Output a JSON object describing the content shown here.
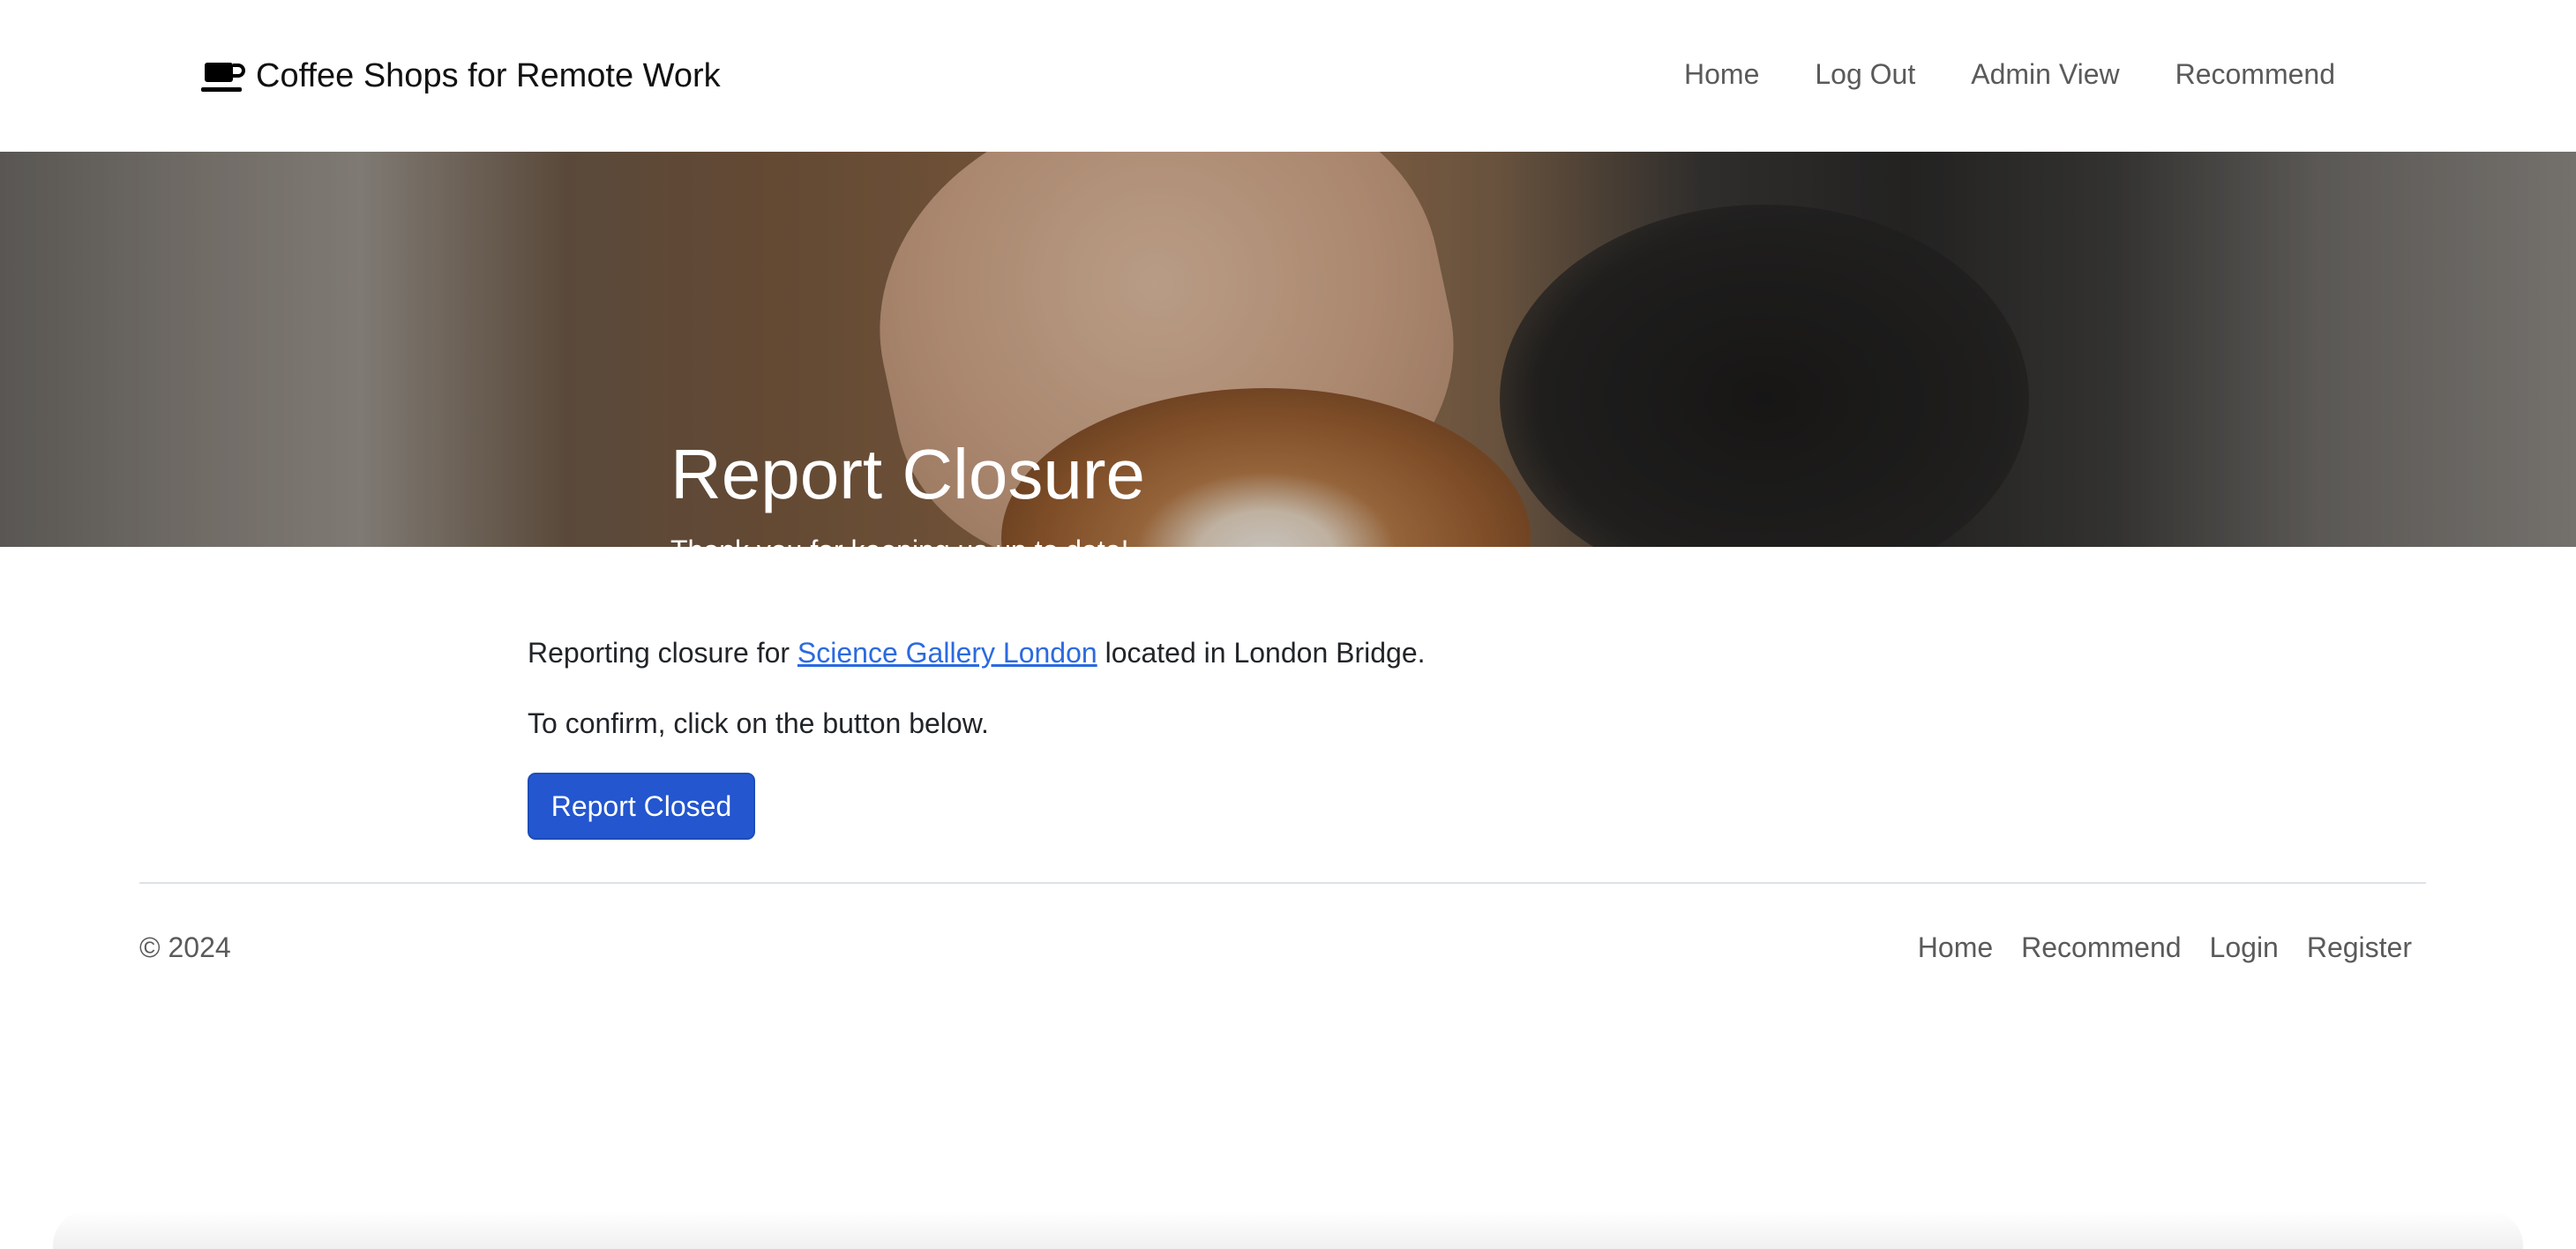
{
  "header": {
    "brand_icon": "coffee-cup-icon",
    "brand_title": "Coffee Shops for Remote Work",
    "nav": [
      {
        "label": "Home"
      },
      {
        "label": "Log Out"
      },
      {
        "label": "Admin View"
      },
      {
        "label": "Recommend"
      }
    ]
  },
  "hero": {
    "title": "Report Closure",
    "subtitle": "Thank you for keeping us up to date!"
  },
  "main": {
    "intro_prefix": "Reporting closure for",
    "shop_name": "Science Gallery London",
    "intro_suffix": "located in London Bridge.",
    "confirm_text": "To confirm, click on the button below.",
    "button_label": "Report Closed"
  },
  "footer": {
    "copyright": "© 2024",
    "links": [
      {
        "label": "Home"
      },
      {
        "label": "Recommend"
      },
      {
        "label": "Login"
      },
      {
        "label": "Register"
      }
    ]
  },
  "colors": {
    "primary_button": "#2356cf",
    "link": "#2b6ae0",
    "nav_text": "#5a5a5a"
  }
}
